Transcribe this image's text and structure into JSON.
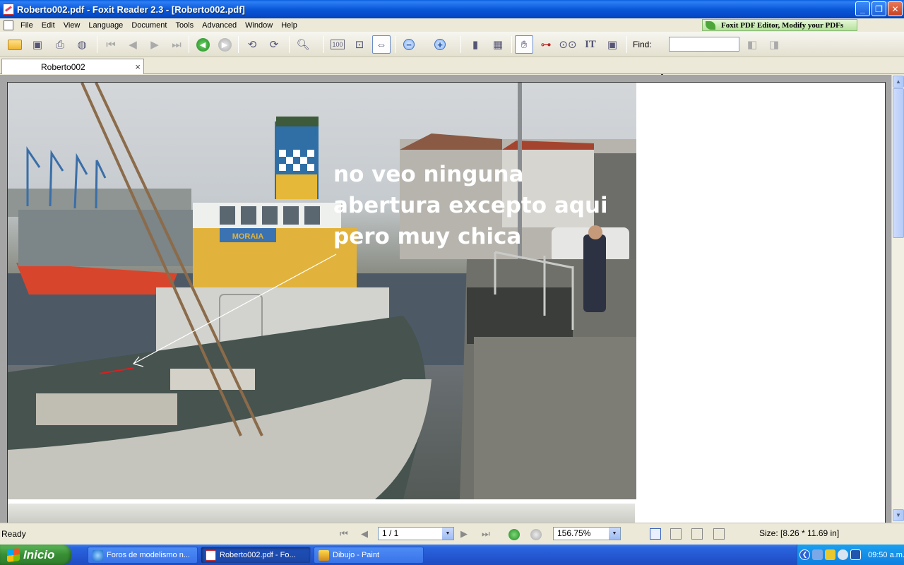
{
  "window": {
    "title": "Roberto002.pdf - Foxit Reader 2.3 - [Roberto002.pdf]",
    "minimize": "_",
    "restore": "❐",
    "close": "✕"
  },
  "menu": {
    "items": [
      "File",
      "Edit",
      "View",
      "Language",
      "Document",
      "Tools",
      "Advanced",
      "Window",
      "Help"
    ],
    "promo": "Foxit PDF Editor, Modify your PDFs"
  },
  "toolbar": {
    "find_label": "Find:",
    "find_value": ""
  },
  "tabs": [
    {
      "label": "Roberto002",
      "close": "×"
    }
  ],
  "document": {
    "annotation_lines": [
      "no veo ninguna",
      "abertura excepto aqui",
      "pero muy chica"
    ],
    "boat_name": "MORAIA"
  },
  "statusbar": {
    "status": "Ready",
    "page": "1 / 1",
    "zoom": "156.75%",
    "size": "Size: [8.26 * 11.69 in]"
  },
  "taskbar": {
    "start": "Inicio",
    "tasks": [
      {
        "label": "Foros de modelismo n..."
      },
      {
        "label": "Roberto002.pdf - Fo..."
      },
      {
        "label": "Dibujo - Paint"
      }
    ],
    "clock": "09:50 a.m."
  },
  "colors": {
    "titlebar": "#0a58d8",
    "annotation_text": "#ffffff",
    "promo_bg": "#b6e29c"
  }
}
